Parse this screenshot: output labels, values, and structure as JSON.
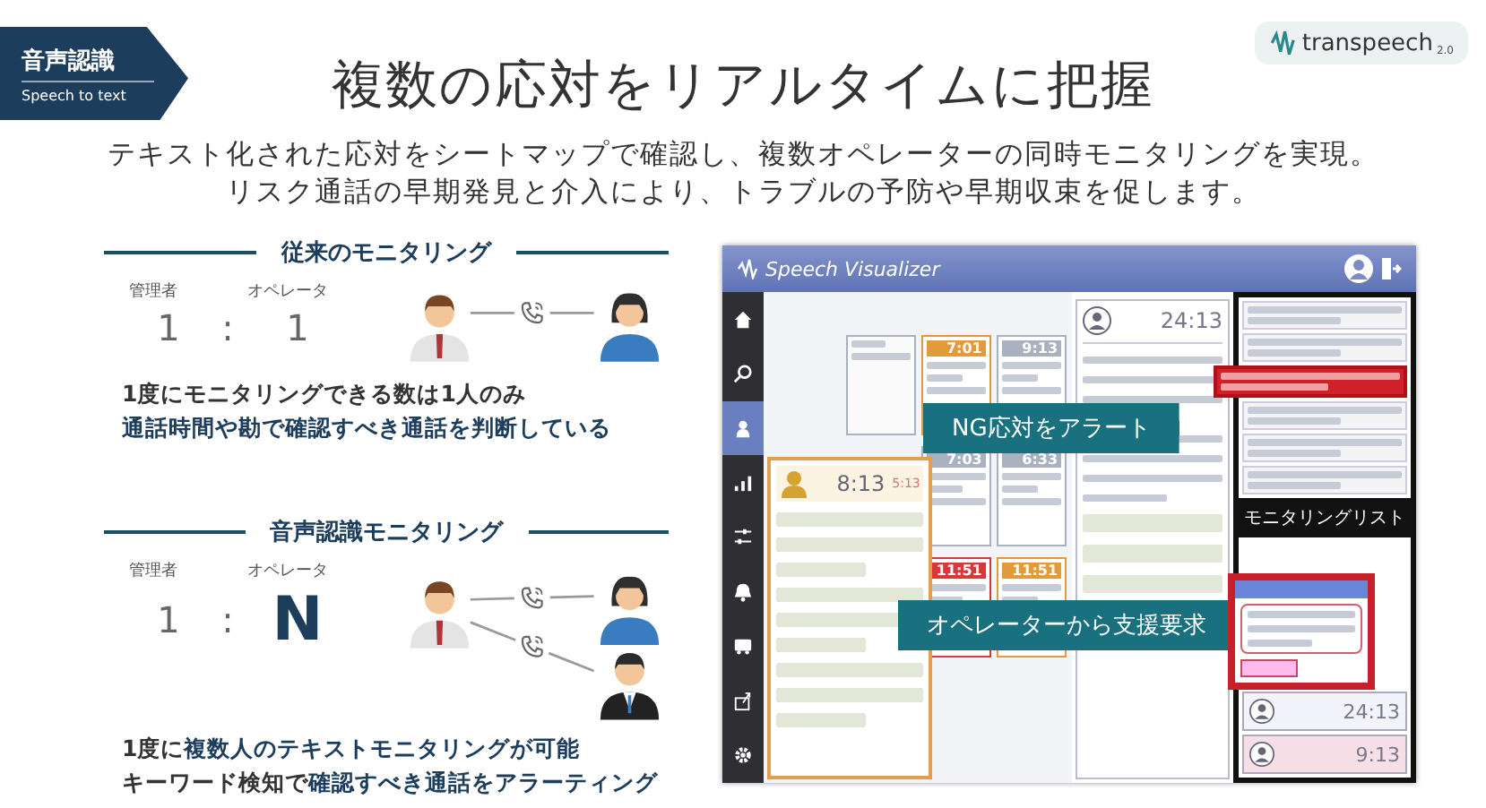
{
  "badge": {
    "title": "音声認識",
    "subtitle": "Speech to text"
  },
  "title": "複数の応対をリアルタイムに把握",
  "logo": {
    "name": "transpeech",
    "version": "2.0"
  },
  "description": [
    "テキスト化された応対をシートマップで確認し、複数オペレーターの同時モニタリングを実現。",
    "リスク通話の早期発見と介入により、トラブルの予防や早期収束を促します。"
  ],
  "sections": [
    {
      "heading": "従来のモニタリング",
      "manager_label": "管理者",
      "operator_label": "オペレータ",
      "manager_count": "1",
      "separator": ":",
      "operator_count": "1",
      "operator_count_emphasized": false,
      "operators": [
        {
          "kind": "female"
        }
      ],
      "notes": [
        {
          "text": "1度にモニタリングできる数は1人のみ",
          "highlighted": false
        },
        {
          "text": "通話時間や勘で確認すべき通話を判断している",
          "highlighted": true
        }
      ]
    },
    {
      "heading": "音声認識モニタリング",
      "manager_label": "管理者",
      "operator_label": "オペレータ",
      "manager_count": "1",
      "separator": ":",
      "operator_count": "N",
      "operator_count_emphasized": true,
      "operators": [
        {
          "kind": "female"
        },
        {
          "kind": "male"
        }
      ],
      "notes": [
        {
          "text": "1度に**複数人のテキストモニタリングが可能**",
          "highlighted": false
        },
        {
          "text": "キーワード検知で**確認すべき通話をアラーティング**",
          "highlighted": false
        }
      ]
    }
  ],
  "app": {
    "product_name": "Speech Visualizer",
    "nav": [
      {
        "kind": "home",
        "selected": false
      },
      {
        "kind": "search",
        "selected": false
      },
      {
        "kind": "person",
        "selected": true
      },
      {
        "kind": "chart",
        "selected": false
      },
      {
        "kind": "sliders",
        "selected": false
      },
      {
        "kind": "bell",
        "selected": false
      },
      {
        "kind": "bus",
        "selected": false
      },
      {
        "kind": "export",
        "selected": false
      },
      {
        "kind": "gear",
        "selected": false
      }
    ],
    "seat_cards": [
      {
        "kind": "vacant"
      },
      {
        "kind": "idle"
      },
      {
        "kind": "call",
        "time": "7:01",
        "color": "#e39a3a"
      },
      {
        "kind": "call",
        "time": "9:13",
        "color": "#a9b0c0"
      },
      {
        "kind": "vacant"
      },
      {
        "kind": "vacant"
      },
      {
        "kind": "call",
        "time": "7:03",
        "color": "#a9b0c0"
      },
      {
        "kind": "call",
        "time": "6:33",
        "color": "#a9b0c0"
      },
      {
        "kind": "vacant"
      },
      {
        "kind": "vacant"
      },
      {
        "kind": "call",
        "time": "11:51",
        "color": "#d9383a"
      },
      {
        "kind": "call",
        "time": "11:51",
        "color": "#e39a3a"
      }
    ],
    "detail_card": {
      "time": "8:13",
      "sub_time": "5:13"
    },
    "detail_panel": {
      "time": "24:13"
    },
    "notifications": [
      {
        "alert": false
      },
      {
        "alert": false
      },
      {
        "alert": true
      },
      {
        "alert": false
      },
      {
        "alert": false
      },
      {
        "alert": false
      }
    ],
    "monitoring_list": {
      "title": "モニタリングリスト",
      "entries": [
        {
          "time": "24:13"
        },
        {
          "time": "9:13"
        }
      ]
    },
    "callouts": [
      {
        "text": "NG応対をアラート"
      },
      {
        "text": "オペレーターから支援要求"
      }
    ]
  }
}
